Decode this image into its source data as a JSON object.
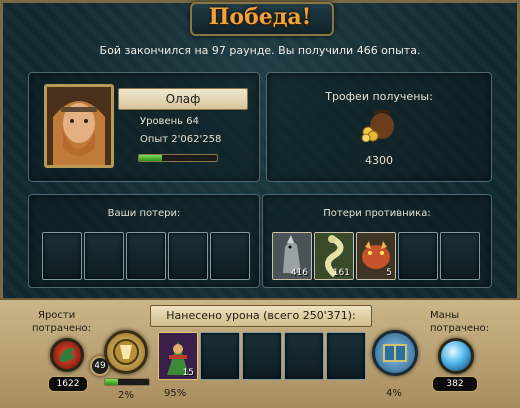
{
  "header": {
    "title": "Победа!",
    "subtitle": "Бой закончился на 97 раунде. Вы получили 466 опыта."
  },
  "hero": {
    "name": "Олаф",
    "level": "Уровень 64",
    "experience": "Опыт 2'062'258",
    "xp_progress": 0.3
  },
  "trophies": {
    "title": "Трофеи получены:",
    "icon": "treasure-bag-icon",
    "amount": "4300"
  },
  "losses": {
    "own_title": "Ваши потери:",
    "enemy_title": "Потери противника:",
    "enemy_units": [
      {
        "icon": "werewolf-unit-icon",
        "count": "416"
      },
      {
        "icon": "serpent-unit-icon",
        "count": "161"
      },
      {
        "icon": "beast-unit-icon",
        "count": "5"
      }
    ]
  },
  "damage": {
    "title": "Нанесено урона (всего 250'371):",
    "rage_label_line1": "Ярости",
    "rage_label_line2": "потрачено:",
    "rage_value": "1622",
    "hero_level_badge": "49",
    "hero_percent": "2%",
    "hero_progress": 0.3,
    "unit_count": "15",
    "unit_percent": "95%",
    "spell_percent": "4%",
    "mana_label_line1": "Маны",
    "mana_label_line2": "потрачено:",
    "mana_value": "382"
  }
}
